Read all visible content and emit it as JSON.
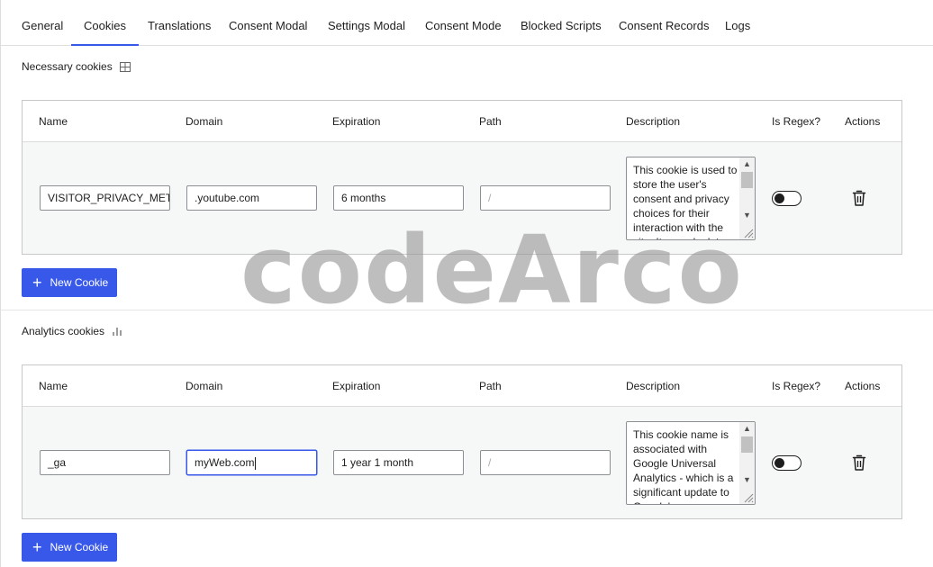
{
  "tabs": [
    {
      "label": "General"
    },
    {
      "label": "Cookies",
      "active": true
    },
    {
      "label": "Translations"
    },
    {
      "label": "Consent Modal"
    },
    {
      "label": "Settings Modal"
    },
    {
      "label": "Consent Mode"
    },
    {
      "label": "Blocked Scripts"
    },
    {
      "label": "Consent Records"
    },
    {
      "label": "Logs"
    }
  ],
  "columns": {
    "name": "Name",
    "domain": "Domain",
    "expiration": "Expiration",
    "path": "Path",
    "description": "Description",
    "is_regex": "Is Regex?",
    "actions": "Actions"
  },
  "sections": [
    {
      "title": "Necessary cookies",
      "icon": "table-icon",
      "row": {
        "name": "VISITOR_PRIVACY_METADATA",
        "domain": ".youtube.com",
        "expiration": "6 months",
        "path_placeholder": "/",
        "description": "This cookie is used to store the user's consent and privacy choices for their interaction with the site. It records data",
        "is_regex": false
      },
      "new_button": "New Cookie"
    },
    {
      "title": "Analytics cookies",
      "icon": "bar-chart-icon",
      "row": {
        "name": "_ga",
        "domain": "myWeb.com",
        "expiration": "1 year 1 month",
        "path_placeholder": "/",
        "description": "This cookie name is associated with Google Universal Analytics - which is a significant update to Google's",
        "is_regex": false
      },
      "new_button": "New Cookie"
    }
  ],
  "watermark": "codeArco",
  "colors": {
    "accent": "#3858e9",
    "row_bg": "#f6f7f7",
    "border": "#c8c8c8"
  }
}
